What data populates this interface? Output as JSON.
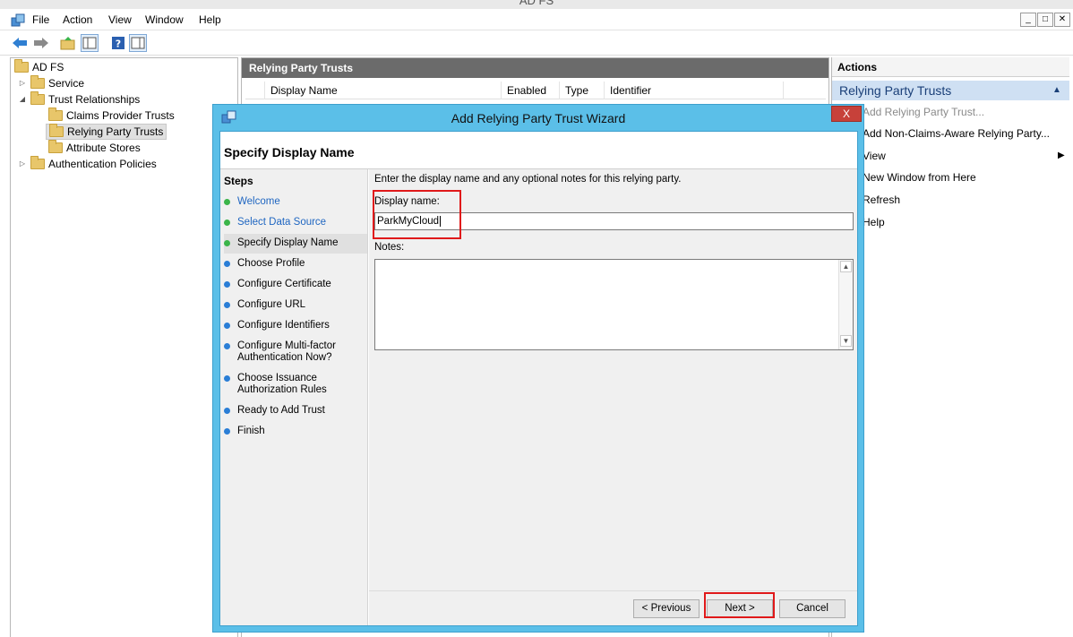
{
  "window": {
    "title": "AD FS"
  },
  "menu": [
    "File",
    "Action",
    "View",
    "Window",
    "Help"
  ],
  "tree": {
    "root": "AD FS",
    "service": "Service",
    "trust_relationships": "Trust Relationships",
    "claims_provider_trusts": "Claims Provider Trusts",
    "relying_party_trusts": "Relying Party Trusts",
    "attribute_stores": "Attribute Stores",
    "authentication_policies": "Authentication Policies"
  },
  "center": {
    "header": "Relying Party Trusts",
    "columns": [
      "Display Name",
      "Enabled",
      "Type",
      "Identifier"
    ]
  },
  "actions": {
    "header": "Actions",
    "section": "Relying Party Trusts",
    "items": [
      "Add Relying Party Trust...",
      "Add Non-Claims-Aware Relying Party...",
      "View",
      "New Window from Here",
      "Refresh",
      "Help"
    ]
  },
  "wizard": {
    "title": "Add Relying Party Trust Wizard",
    "close": "X",
    "heading": "Specify Display Name",
    "steps_title": "Steps",
    "steps": [
      {
        "label": "Welcome",
        "status": "done"
      },
      {
        "label": "Select Data Source",
        "status": "done"
      },
      {
        "label": "Specify Display Name",
        "status": "current"
      },
      {
        "label": "Choose Profile",
        "status": "pending"
      },
      {
        "label": "Configure Certificate",
        "status": "pending"
      },
      {
        "label": "Configure URL",
        "status": "pending"
      },
      {
        "label": "Configure Identifiers",
        "status": "pending"
      },
      {
        "label": "Configure Multi-factor Authentication Now?",
        "status": "pending"
      },
      {
        "label": "Choose Issuance Authorization Rules",
        "status": "pending"
      },
      {
        "label": "Ready to Add Trust",
        "status": "pending"
      },
      {
        "label": "Finish",
        "status": "pending"
      }
    ],
    "instruction": "Enter the display name and any optional notes for this relying party.",
    "display_name_label": "Display name:",
    "display_name_value": "ParkMyCloud",
    "notes_label": "Notes:",
    "notes_value": "",
    "buttons": {
      "previous": "< Previous",
      "next": "Next >",
      "cancel": "Cancel"
    }
  },
  "colors": {
    "wizard_frame": "#5bbfe8",
    "highlight": "#e0191a",
    "header_gray": "#6b6b6b",
    "actions_section": "#cfe0f3"
  }
}
